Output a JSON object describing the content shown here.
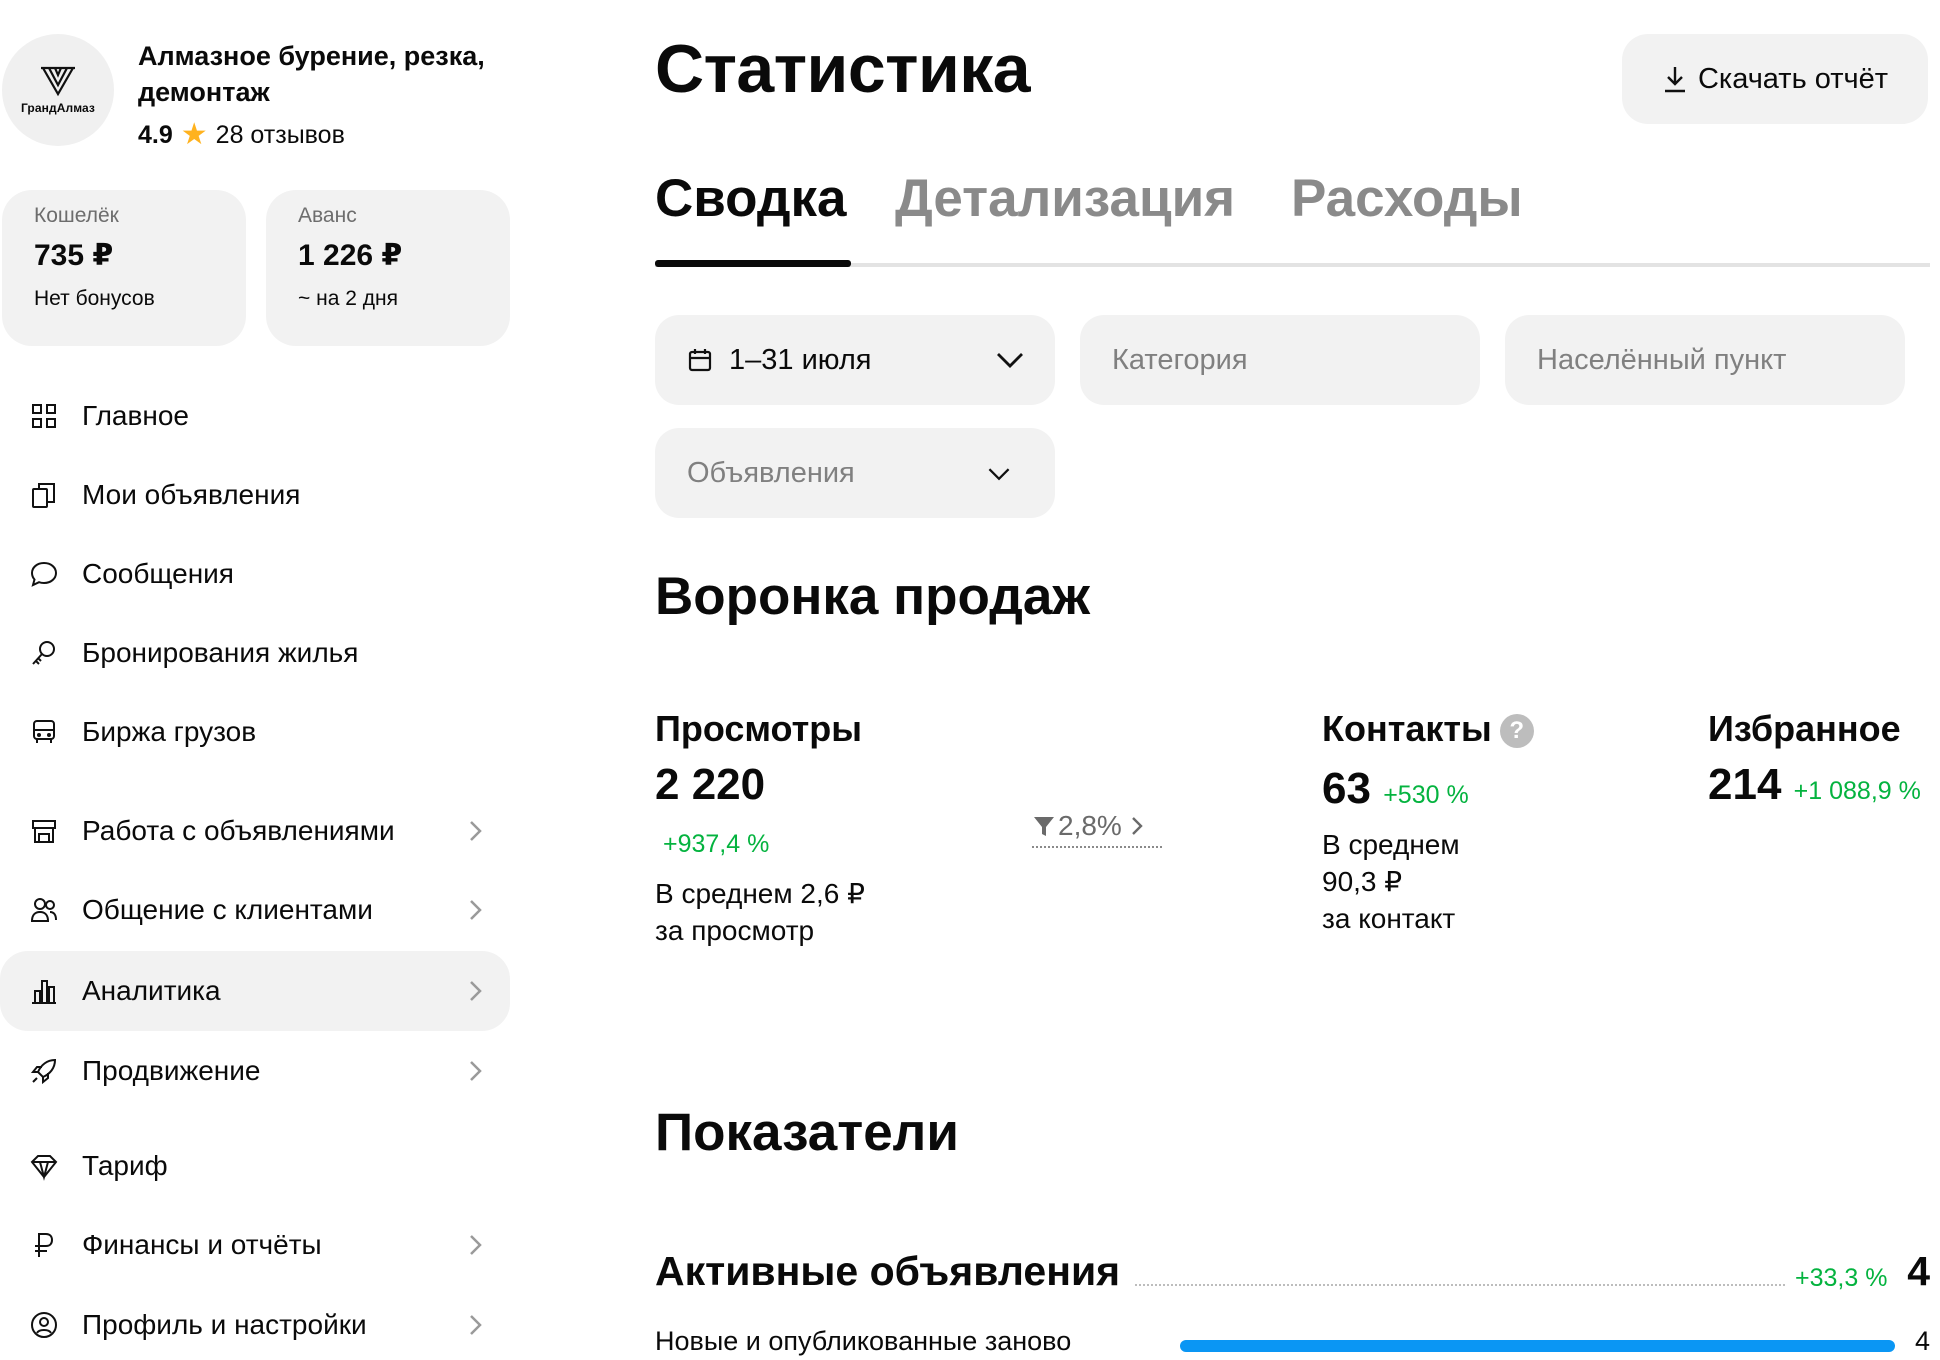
{
  "profile": {
    "logo_text": "ГрандАлмаз",
    "company_name": "Алмазное бурение, резка, демонтаж",
    "rating": "4.9",
    "reviews": "28 отзывов"
  },
  "wallet": {
    "label": "Кошелёк",
    "amount": "735 ₽",
    "note": "Нет бонусов"
  },
  "advance": {
    "label": "Аванс",
    "amount": "1 226 ₽",
    "note": "~ на 2 дня"
  },
  "nav": [
    {
      "label": "Главное",
      "icon": "grid-icon"
    },
    {
      "label": "Мои объявления",
      "icon": "copy-icon"
    },
    {
      "label": "Сообщения",
      "icon": "chat-icon"
    },
    {
      "label": "Бронирования жилья",
      "icon": "key-icon"
    },
    {
      "label": "Биржа грузов",
      "icon": "truck-icon"
    },
    {
      "label": "Работа с объявлениями",
      "icon": "store-icon"
    },
    {
      "label": "Общение с клиентами",
      "icon": "users-icon"
    },
    {
      "label": "Аналитика",
      "icon": "chart-icon",
      "active": true
    },
    {
      "label": "Продвижение",
      "icon": "rocket-icon"
    },
    {
      "label": "Тариф",
      "icon": "diamond-icon"
    },
    {
      "label": "Финансы и отчёты",
      "icon": "ruble-icon"
    },
    {
      "label": "Профиль и настройки",
      "icon": "profile-icon"
    }
  ],
  "header": {
    "title": "Статистика",
    "download_label": "Скачать отчёт"
  },
  "tabs": [
    {
      "label": "Сводка",
      "active": true
    },
    {
      "label": "Детализация"
    },
    {
      "label": "Расходы"
    }
  ],
  "filters": {
    "period": "1–31 июля",
    "category_placeholder": "Категория",
    "locality_placeholder": "Населённый пункт",
    "ads_placeholder": "Объявления"
  },
  "funnel": {
    "title": "Воронка продаж",
    "views": {
      "title": "Просмотры",
      "value": "2 220",
      "delta": "+937,4 %",
      "note_line1": "В среднем 2,6 ₽",
      "note_line2": "за просмотр"
    },
    "conversion": "2,8%",
    "contacts": {
      "title": "Контакты",
      "help": "?",
      "value": "63",
      "delta": "+530 %",
      "note_line1": "В среднем",
      "note_line2": "90,3 ₽",
      "note_line3": "за контакт"
    },
    "favorites": {
      "title": "Избранное",
      "value": "214",
      "delta": "+1 088,9 %"
    }
  },
  "indicators": {
    "title": "Показатели",
    "active_ads": {
      "label": "Активные объявления",
      "delta": "+33,3 %",
      "value": "4"
    },
    "new_ads": {
      "label": "Новые и опубликованные заново",
      "value": "4",
      "bar_fraction": 1.0
    }
  },
  "colors": {
    "accent_green": "#04b33f",
    "bar_blue": "#0a96f4",
    "star": "#ffb21e",
    "card_bg": "#f2f2f2"
  }
}
